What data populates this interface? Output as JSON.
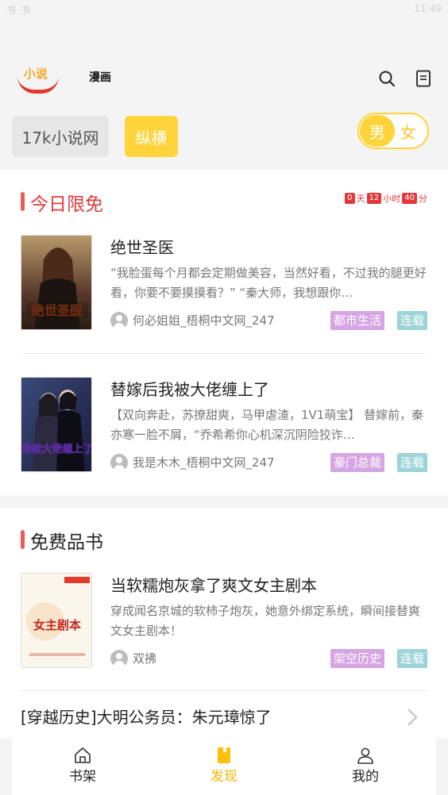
{
  "status_bar": {
    "left": "书 书",
    "right": "11:49"
  },
  "header": {
    "logo_text": "小说",
    "tab_manhua": "漫画"
  },
  "sources": {
    "source_1": "17k小说网",
    "source_2": "纵横"
  },
  "gender": {
    "male": "男",
    "female": "女"
  },
  "today_free": {
    "title": "今日限免",
    "countdown": {
      "days": "0",
      "days_unit": "天",
      "hours": "12",
      "hours_unit": "小时",
      "minutes": "40",
      "minutes_unit": "分"
    },
    "books": [
      {
        "title": "绝世圣医",
        "desc": "“我脸蛋每个月都会定期做美容，当然好看，不过我的腿更好看，你要不要摸摸看？” “秦大师，我想跟你…",
        "author": "何必姐姐_梧桐中文网_247",
        "genre": "都市生活",
        "status": "连载",
        "cover_text": "绝世圣医"
      },
      {
        "title": "替嫁后我被大佬缠上了",
        "desc": "【双向奔赴，苏撩甜爽，马甲虐渣，1V1萌宝】 替嫁前，秦亦寒一脸不屑，“乔希希你心机深沉阴险狡诈…",
        "author": "我是木木_梧桐中文网_247",
        "genre": "豪门总裁",
        "status": "连载",
        "cover_text": "我被大佬缠上了"
      }
    ]
  },
  "free_picks": {
    "title": "免费品书",
    "books": [
      {
        "title": "当软糯炮灰拿了爽文女主剧本",
        "desc": "穿成闻名京城的软柿子炮灰，她意外绑定系统，瞬间接替爽文女主剧本！",
        "author": "双拂",
        "genre": "架空历史",
        "status": "连载",
        "cover_text": "女主剧本"
      }
    ],
    "list_item": "[穿越历史]大明公务员：朱元璋惊了"
  },
  "bottom_nav": {
    "shelf": "书架",
    "discover": "发现",
    "mine": "我的"
  },
  "colors": {
    "accent_yellow": "#ffd43b",
    "red": "#e3393c",
    "tag_purple": "#d6a5e3",
    "tag_teal": "#9cd4d8"
  }
}
